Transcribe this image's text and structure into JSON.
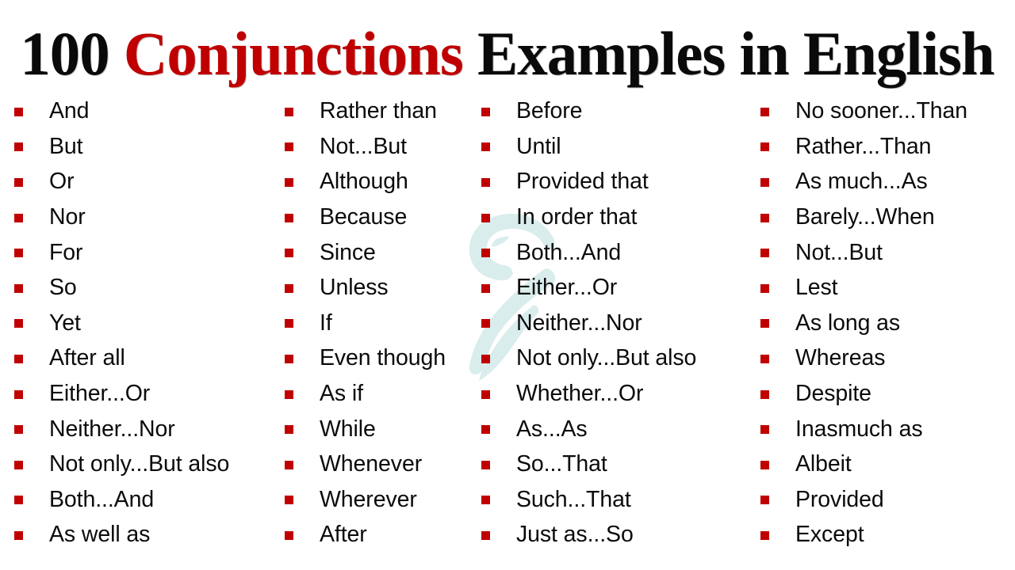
{
  "title": {
    "part1": "100 ",
    "accent": "Conjunctions",
    "part2": " Examples in English",
    "full": "100 Conjunctions Examples in English"
  },
  "colors": {
    "accent_red": "#C00000",
    "bullet_red": "#C00000",
    "title_black": "#0A0A0A",
    "watermark_teal": "#D9EDEC",
    "background": "#FFFFFF"
  },
  "watermark": {
    "icon": "quill-swoosh-logo-watermark"
  },
  "columns": [
    {
      "items": [
        "And",
        "But",
        "Or",
        "Nor",
        "For",
        "So",
        "Yet",
        "After all",
        "Either...Or",
        "Neither...Nor",
        "Not only...But also",
        "Both...And",
        "As well as"
      ]
    },
    {
      "items": [
        "Rather than",
        "Not...But",
        "Although",
        "Because",
        "Since",
        "Unless",
        "If",
        "Even though",
        "As if",
        "While",
        "Whenever",
        "Wherever",
        "After"
      ]
    },
    {
      "items": [
        "Before",
        "Until",
        "Provided that",
        "In order that",
        "Both...And",
        "Either...Or",
        "Neither...Nor",
        "Not only...But also",
        "Whether...Or",
        "As...As",
        "So...That",
        "Such...That",
        "Just as...So"
      ]
    },
    {
      "items": [
        "No sooner...Than",
        "Rather...Than",
        "As much...As",
        "Barely...When",
        "Not...But",
        "Lest",
        "As long as",
        "Whereas",
        "Despite",
        "Inasmuch as",
        "Albeit",
        "Provided",
        "Except"
      ]
    }
  ]
}
